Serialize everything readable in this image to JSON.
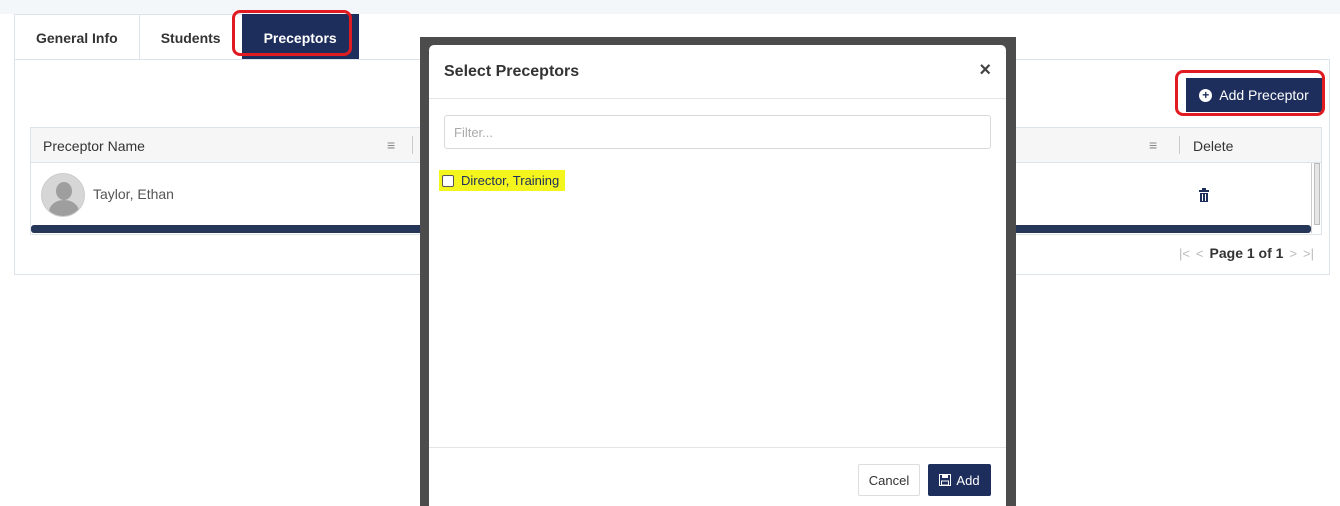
{
  "tabs": [
    {
      "label": "General Info"
    },
    {
      "label": "Students"
    },
    {
      "label": "Preceptors"
    }
  ],
  "add_preceptor_button": {
    "label": "Add Preceptor",
    "icon": "plus-circle-icon"
  },
  "grid": {
    "columns": [
      {
        "label": "Preceptor Name"
      },
      {
        "label": "Delete"
      }
    ],
    "rows": [
      {
        "name": "Taylor, Ethan",
        "icon": "avatar-placeholder"
      }
    ],
    "delete_icon": "trash-icon"
  },
  "pager": {
    "label": "Page 1 of 1"
  },
  "modal": {
    "title": "Select Preceptors",
    "close_label": "×",
    "filter": {
      "placeholder": "Filter...",
      "value": ""
    },
    "options": [
      {
        "label": "Director, Training",
        "checked": false
      }
    ],
    "cancel_label": "Cancel",
    "add_label": "Add"
  },
  "colors": {
    "brand_navy": "#1d2e5c",
    "annotation_red": "#e11b22",
    "highlight_yellow": "#f5f51e"
  }
}
